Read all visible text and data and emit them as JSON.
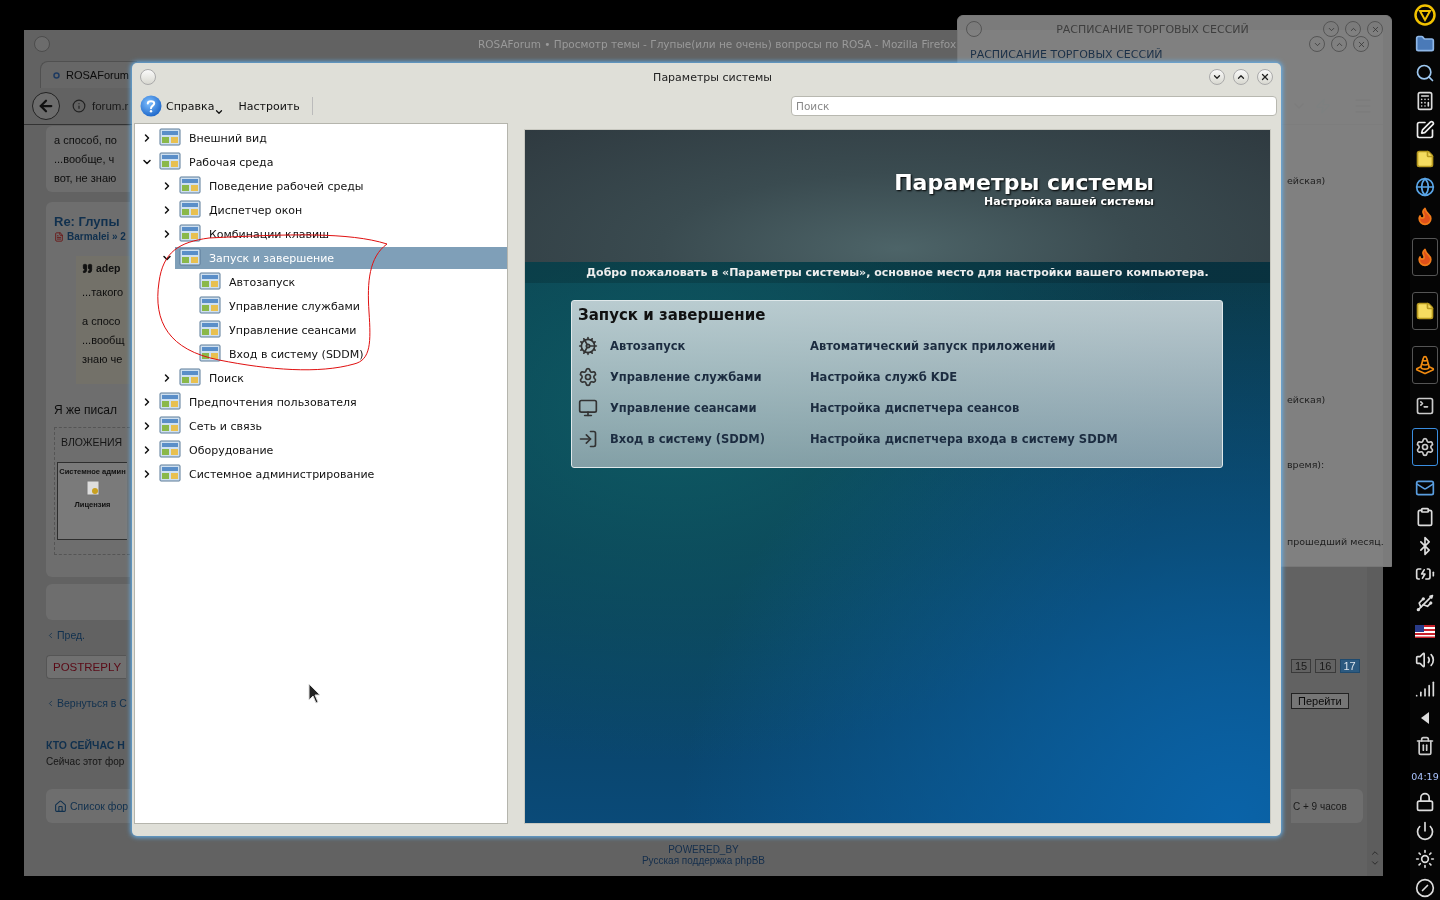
{
  "browser": {
    "title": "ROSAForum • Просмотр темы - Глупые(или не очень) вопросы по ROSA - Mozilla Firefox",
    "tab": "ROSAForum",
    "url": "forum.r",
    "post_lines": [
      "а способ, по",
      "...вообще, ч",
      "вот, не знаю"
    ],
    "post_title": "Re: Глупы",
    "post_author": "Barmalei » 2",
    "quote_author": "adep",
    "quote_lines": [
      "...такого",
      "а спосо",
      "...вообщ",
      "знаю че"
    ],
    "post_text": "Я же писал",
    "attachments_label": "ВЛОЖЕНИЯ",
    "thumb_title": "Системное админ",
    "thumb_caption": "Лицензия",
    "prev_link": "Пред.",
    "reply_button": "POSTREPLY",
    "back_link": "Вернуться в С",
    "online_heading": "КТО СЕЙЧАС Н",
    "online_text": "Сейчас этот фор",
    "forum_list_link": "Список фор",
    "pages": [
      {
        "label": "15",
        "selected": false
      },
      {
        "label": "16",
        "selected": false
      },
      {
        "label": "17",
        "selected": true
      }
    ],
    "go_button": "Перейти",
    "timezone": "С + 9 часов",
    "powered_by": "POWERED_BY",
    "support": "Русская поддержка phpBB"
  },
  "schedule_window": {
    "title": "РАСПИСАНИЕ ТОРГОВЫХ СЕССИЙ",
    "heading": "РАСПИСАНИЕ ТОРГОВЫХ СЕССИЙ",
    "lines": [
      "ейская)",
      "ейская)",
      "время):",
      "прошедший месяц."
    ]
  },
  "dialog": {
    "title": "Параметры системы",
    "help": "Справка",
    "configure": "Настроить",
    "search": {
      "placeholder": "Поиск"
    },
    "tree": [
      {
        "label": "Внешний вид",
        "expanded": false,
        "selected": false
      },
      {
        "label": "Рабочая среда",
        "expanded": true,
        "selected": false,
        "children": [
          {
            "label": "Поведение рабочей среды",
            "expanded": false,
            "selected": false
          },
          {
            "label": "Диспетчер окон",
            "expanded": false,
            "selected": false
          },
          {
            "label": "Комбинации клавиш",
            "expanded": false,
            "selected": false
          },
          {
            "label": "Запуск и завершение",
            "expanded": true,
            "selected": true,
            "children": [
              {
                "label": "Автозапуск",
                "selected": false
              },
              {
                "label": "Управление службами",
                "selected": false
              },
              {
                "label": "Управление сеансами",
                "selected": false
              },
              {
                "label": "Вход в систему (SDDM)",
                "selected": false
              }
            ]
          },
          {
            "label": "Поиск",
            "expanded": false,
            "selected": false
          }
        ]
      },
      {
        "label": "Предпочтения пользователя",
        "expanded": false,
        "selected": false
      },
      {
        "label": "Сеть и связь",
        "expanded": false,
        "selected": false
      },
      {
        "label": "Оборудование",
        "expanded": false,
        "selected": false
      },
      {
        "label": "Системное администрирование",
        "expanded": false,
        "selected": false
      }
    ],
    "header_title": "Параметры системы",
    "header_subtitle": "Настройка вашей системы",
    "welcome": "Добро пожаловать в «Параметры системы», основное место для настройки вашего компьютера.",
    "card": {
      "title": "Запуск и завершение",
      "rows": [
        {
          "name": "Автозапуск",
          "description": "Автоматический запуск приложений"
        },
        {
          "name": "Управление службами",
          "description": "Настройка служб KDE"
        },
        {
          "name": "Управление сеансами",
          "description": "Настройка диспетчера сеансов"
        },
        {
          "name": "Вход в систему (SDDM)",
          "description": "Настройка диспетчера входа в систему SDDM"
        }
      ]
    }
  },
  "dock": {
    "items": [
      {
        "kind": "logo",
        "running": false,
        "selected": false
      },
      {
        "kind": "folder",
        "running": false,
        "selected": false
      },
      {
        "kind": "search",
        "running": false,
        "selected": false
      },
      {
        "kind": "calculator",
        "running": false,
        "selected": false
      },
      {
        "kind": "editor",
        "running": false,
        "selected": false
      },
      {
        "kind": "note",
        "running": false,
        "selected": false
      },
      {
        "kind": "browser",
        "running": false,
        "selected": false
      },
      {
        "kind": "firefox",
        "running": false,
        "selected": false
      },
      {
        "kind": "firefox",
        "running": true,
        "selected": false
      },
      {
        "kind": "note",
        "running": true,
        "selected": false
      },
      {
        "kind": "cone",
        "running": true,
        "selected": false
      },
      {
        "kind": "terminal",
        "running": false,
        "selected": false
      },
      {
        "kind": "settings",
        "running": true,
        "selected": true
      },
      {
        "kind": "mail",
        "running": false,
        "selected": false
      },
      {
        "kind": "clipboard",
        "running": false,
        "selected": false
      },
      {
        "kind": "bluetooth",
        "running": false,
        "selected": false
      },
      {
        "kind": "battery",
        "running": false,
        "selected": false
      },
      {
        "kind": "usb",
        "running": false,
        "selected": false
      },
      {
        "kind": "flag",
        "running": false,
        "selected": false
      },
      {
        "kind": "volume",
        "running": false,
        "selected": false
      },
      {
        "kind": "signal",
        "running": false,
        "selected": false
      },
      {
        "kind": "back",
        "running": false,
        "selected": false
      },
      {
        "kind": "trash",
        "running": false,
        "selected": false
      }
    ],
    "clock": "04:19",
    "bottom": [
      {
        "kind": "lock",
        "running": false,
        "selected": false
      },
      {
        "kind": "power",
        "running": false,
        "selected": false
      },
      {
        "kind": "sun",
        "running": false,
        "selected": false
      },
      {
        "kind": "circle",
        "running": false,
        "selected": false
      }
    ]
  }
}
